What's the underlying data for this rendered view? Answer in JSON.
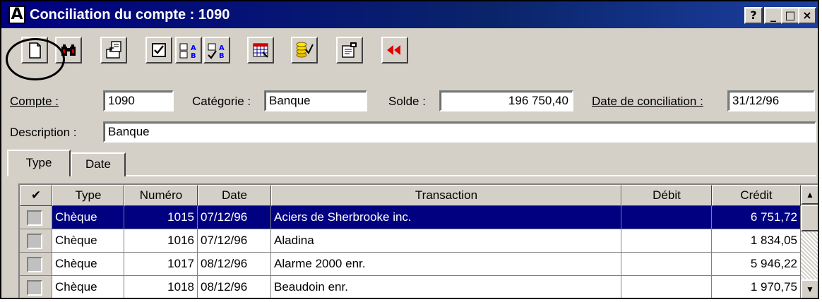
{
  "window": {
    "title": "Conciliation du compte : 1090",
    "app_icon_letter": "A",
    "buttons": {
      "help": "?",
      "minimize": "_",
      "maximize": "□",
      "close": "×"
    }
  },
  "toolbar": {
    "icons": [
      "new-document-icon",
      "binoculars-icon",
      "export-icon",
      "checkbox-icon",
      "sort-ab-icon",
      "sort-ab-checked-icon",
      "calendar-grid-icon",
      "coins-check-icon",
      "properties-icon",
      "rewind-icon"
    ]
  },
  "form": {
    "compte_label": "Compte :",
    "compte_value": "1090",
    "categorie_label": "Catégorie :",
    "categorie_value": "Banque",
    "solde_label": "Solde :",
    "solde_value": "196 750,40",
    "date_label": "Date de conciliation :",
    "date_value": "31/12/96",
    "description_label": "Description :",
    "description_value": "Banque"
  },
  "tabs": [
    {
      "label": "Type",
      "active": true
    },
    {
      "label": "Date",
      "active": false
    }
  ],
  "table": {
    "headers": {
      "check": "✔",
      "type": "Type",
      "numero": "Numéro",
      "date": "Date",
      "transaction": "Transaction",
      "debit": "Débit",
      "credit": "Crédit"
    },
    "rows": [
      {
        "type": "Chèque",
        "numero": "1015",
        "date": "07/12/96",
        "transaction": "Aciers de Sherbrooke inc.",
        "debit": "",
        "credit": "6 751,72",
        "selected": true
      },
      {
        "type": "Chèque",
        "numero": "1016",
        "date": "07/12/96",
        "transaction": "Aladina",
        "debit": "",
        "credit": "1 834,05",
        "selected": false
      },
      {
        "type": "Chèque",
        "numero": "1017",
        "date": "08/12/96",
        "transaction": "Alarme 2000 enr.",
        "debit": "",
        "credit": "5 946,22",
        "selected": false
      },
      {
        "type": "Chèque",
        "numero": "1018",
        "date": "08/12/96",
        "transaction": "Beaudoin enr.",
        "debit": "",
        "credit": "1 970,75",
        "selected": false
      }
    ]
  },
  "colors": {
    "titlebar": "#000080",
    "selection": "#000080",
    "face": "#d4d0c8",
    "rewind_red": "#e00000"
  }
}
